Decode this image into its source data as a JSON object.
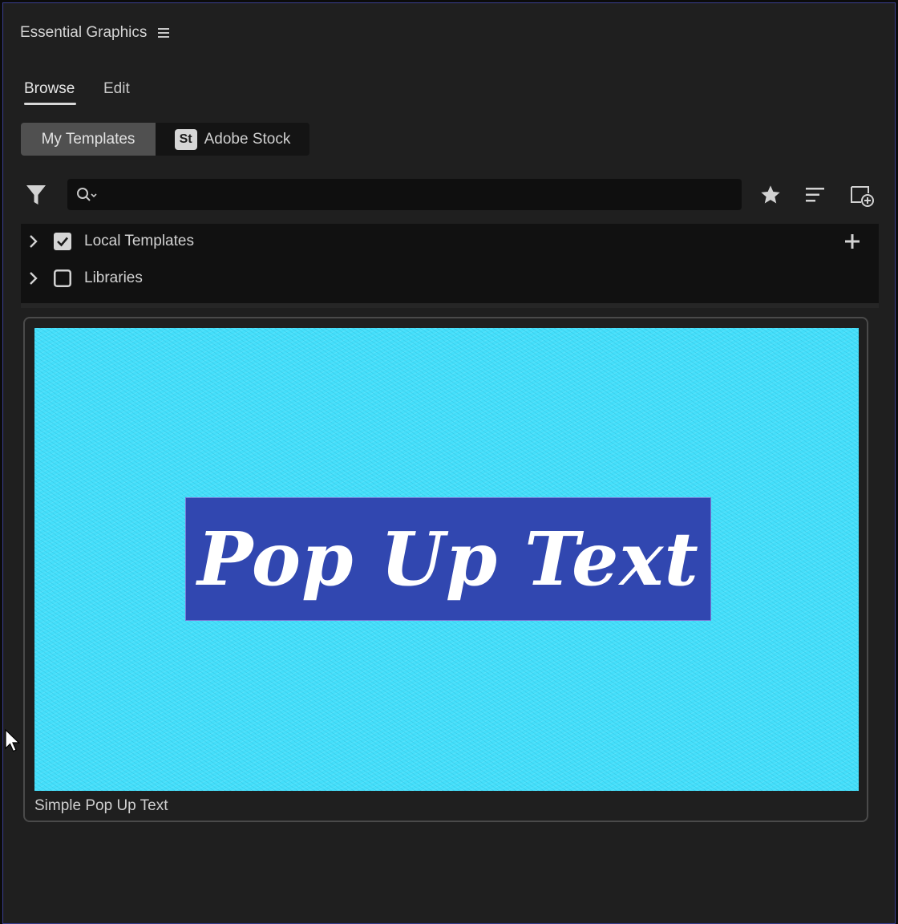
{
  "panel": {
    "title": "Essential Graphics",
    "menu_icon": "hamburger-menu-icon"
  },
  "tabs": [
    {
      "label": "Browse",
      "active": true
    },
    {
      "label": "Edit",
      "active": false
    }
  ],
  "source_toggle": {
    "my_templates": "My Templates",
    "adobe_stock_badge": "St",
    "adobe_stock": "Adobe Stock",
    "selected": "My Templates"
  },
  "search": {
    "value": "",
    "placeholder": ""
  },
  "toolbar_icons": [
    "filter-icon",
    "search-icon",
    "star-icon",
    "sort-icon",
    "new-item-icon"
  ],
  "tree": {
    "items": [
      {
        "label": "Local Templates",
        "checked": true
      },
      {
        "label": "Libraries",
        "checked": false
      }
    ]
  },
  "templates": [
    {
      "name": "Simple Pop Up Text",
      "thumbnail_text": "Pop Up Text"
    }
  ],
  "colors": {
    "panel_bg": "#1f1f1f",
    "thumbnail_bg": "#45dffb",
    "title_box": "#3147b0"
  }
}
